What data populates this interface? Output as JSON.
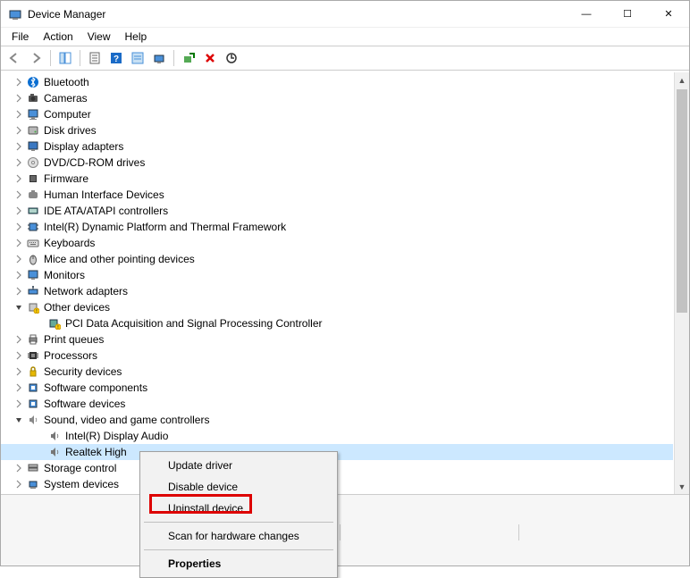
{
  "title": "Device Manager",
  "menus": [
    "File",
    "Action",
    "View",
    "Help"
  ],
  "winbtns": {
    "min": "—",
    "max": "☐",
    "close": "✕"
  },
  "toolbar": {
    "back": "back-arrow",
    "forward": "forward-arrow",
    "showhide": "show-hide-tree",
    "properties": "properties",
    "help": "help",
    "refresh": "refresh",
    "monitor": "monitor",
    "addhw": "add-hardware",
    "uninstall": "uninstall",
    "scan": "scan-hardware"
  },
  "tree": [
    {
      "label": "Bluetooth",
      "icon": "bluetooth",
      "expander": "collapsed",
      "depth": 1
    },
    {
      "label": "Cameras",
      "icon": "camera",
      "expander": "collapsed",
      "depth": 1
    },
    {
      "label": "Computer",
      "icon": "computer",
      "expander": "collapsed",
      "depth": 1
    },
    {
      "label": "Disk drives",
      "icon": "disk",
      "expander": "collapsed",
      "depth": 1
    },
    {
      "label": "Display adapters",
      "icon": "display",
      "expander": "collapsed",
      "depth": 1
    },
    {
      "label": "DVD/CD-ROM drives",
      "icon": "dvd",
      "expander": "collapsed",
      "depth": 1
    },
    {
      "label": "Firmware",
      "icon": "firmware",
      "expander": "collapsed",
      "depth": 1
    },
    {
      "label": "Human Interface Devices",
      "icon": "hid",
      "expander": "collapsed",
      "depth": 1
    },
    {
      "label": "IDE ATA/ATAPI controllers",
      "icon": "ide",
      "expander": "collapsed",
      "depth": 1
    },
    {
      "label": "Intel(R) Dynamic Platform and Thermal Framework",
      "icon": "chip",
      "expander": "collapsed",
      "depth": 1
    },
    {
      "label": "Keyboards",
      "icon": "keyboard",
      "expander": "collapsed",
      "depth": 1
    },
    {
      "label": "Mice and other pointing devices",
      "icon": "mouse",
      "expander": "collapsed",
      "depth": 1
    },
    {
      "label": "Monitors",
      "icon": "monitor",
      "expander": "collapsed",
      "depth": 1
    },
    {
      "label": "Network adapters",
      "icon": "network",
      "expander": "collapsed",
      "depth": 1
    },
    {
      "label": "Other devices",
      "icon": "other",
      "expander": "expanded",
      "depth": 1
    },
    {
      "label": "PCI Data Acquisition and Signal Processing Controller",
      "icon": "other-warn",
      "expander": "none",
      "depth": 2
    },
    {
      "label": "Print queues",
      "icon": "print",
      "expander": "collapsed",
      "depth": 1
    },
    {
      "label": "Processors",
      "icon": "cpu",
      "expander": "collapsed",
      "depth": 1
    },
    {
      "label": "Security devices",
      "icon": "security",
      "expander": "collapsed",
      "depth": 1
    },
    {
      "label": "Software components",
      "icon": "software",
      "expander": "collapsed",
      "depth": 1
    },
    {
      "label": "Software devices",
      "icon": "software",
      "expander": "collapsed",
      "depth": 1
    },
    {
      "label": "Sound, video and game controllers",
      "icon": "sound",
      "expander": "expanded",
      "depth": 1
    },
    {
      "label": "Intel(R) Display Audio",
      "icon": "audio",
      "expander": "none",
      "depth": 2
    },
    {
      "label": "Realtek High Definition Audio",
      "icon": "audio",
      "expander": "none",
      "depth": 2,
      "selected": true,
      "truncated": "Realtek High "
    },
    {
      "label": "Storage controllers",
      "icon": "storage",
      "expander": "collapsed",
      "depth": 1,
      "truncated": "Storage control"
    },
    {
      "label": "System devices",
      "icon": "system",
      "expander": "collapsed",
      "depth": 1,
      "truncated": "System devices"
    }
  ],
  "context_menu": {
    "items": [
      {
        "label": "Update driver",
        "type": "item"
      },
      {
        "label": "Disable device",
        "type": "item"
      },
      {
        "label": "Uninstall device",
        "type": "item",
        "highlighted": true
      },
      {
        "type": "sep"
      },
      {
        "label": "Scan for hardware changes",
        "type": "item"
      },
      {
        "type": "sep"
      },
      {
        "label": "Properties",
        "type": "item",
        "bold": true
      }
    ]
  }
}
